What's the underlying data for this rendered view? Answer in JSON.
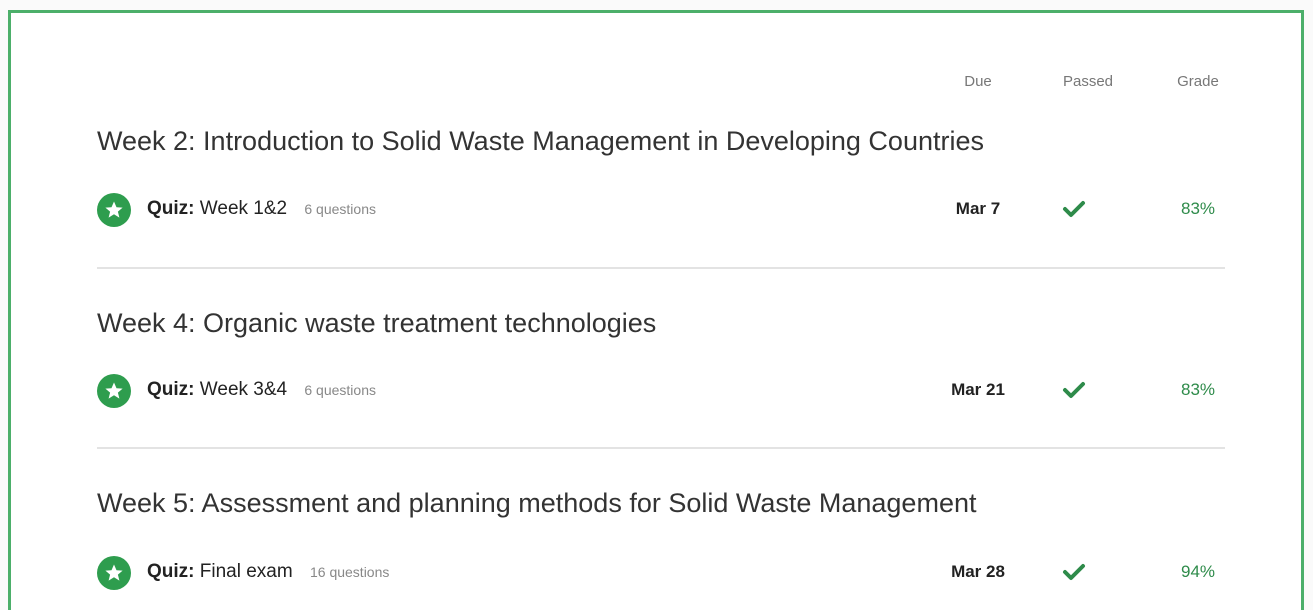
{
  "columns": {
    "due": "Due",
    "passed": "Passed",
    "grade": "Grade"
  },
  "weeks": [
    {
      "title": "Week 2: Introduction to Solid Waste Management in Developing Countries",
      "item": {
        "kind": "Quiz:",
        "name": "Week 1&2",
        "questions": "6 questions",
        "due": "Mar 7",
        "passed": true,
        "grade": "83%"
      }
    },
    {
      "title": "Week 4: Organic waste treatment technologies",
      "item": {
        "kind": "Quiz:",
        "name": "Week 3&4",
        "questions": "6 questions",
        "due": "Mar 21",
        "passed": true,
        "grade": "83%"
      }
    },
    {
      "title": "Week 5: Assessment and planning methods for Solid Waste Management",
      "item": {
        "kind": "Quiz:",
        "name": "Final exam",
        "questions": "16 questions",
        "due": "Mar 28",
        "passed": true,
        "grade": "94%"
      }
    }
  ],
  "icons": {
    "item_icon": "star-circle-icon",
    "passed_icon": "checkmark-icon"
  },
  "colors": {
    "accent_green": "#2e9d4e",
    "border_green": "#4caf6a",
    "grade_green": "#2e8b4a"
  }
}
